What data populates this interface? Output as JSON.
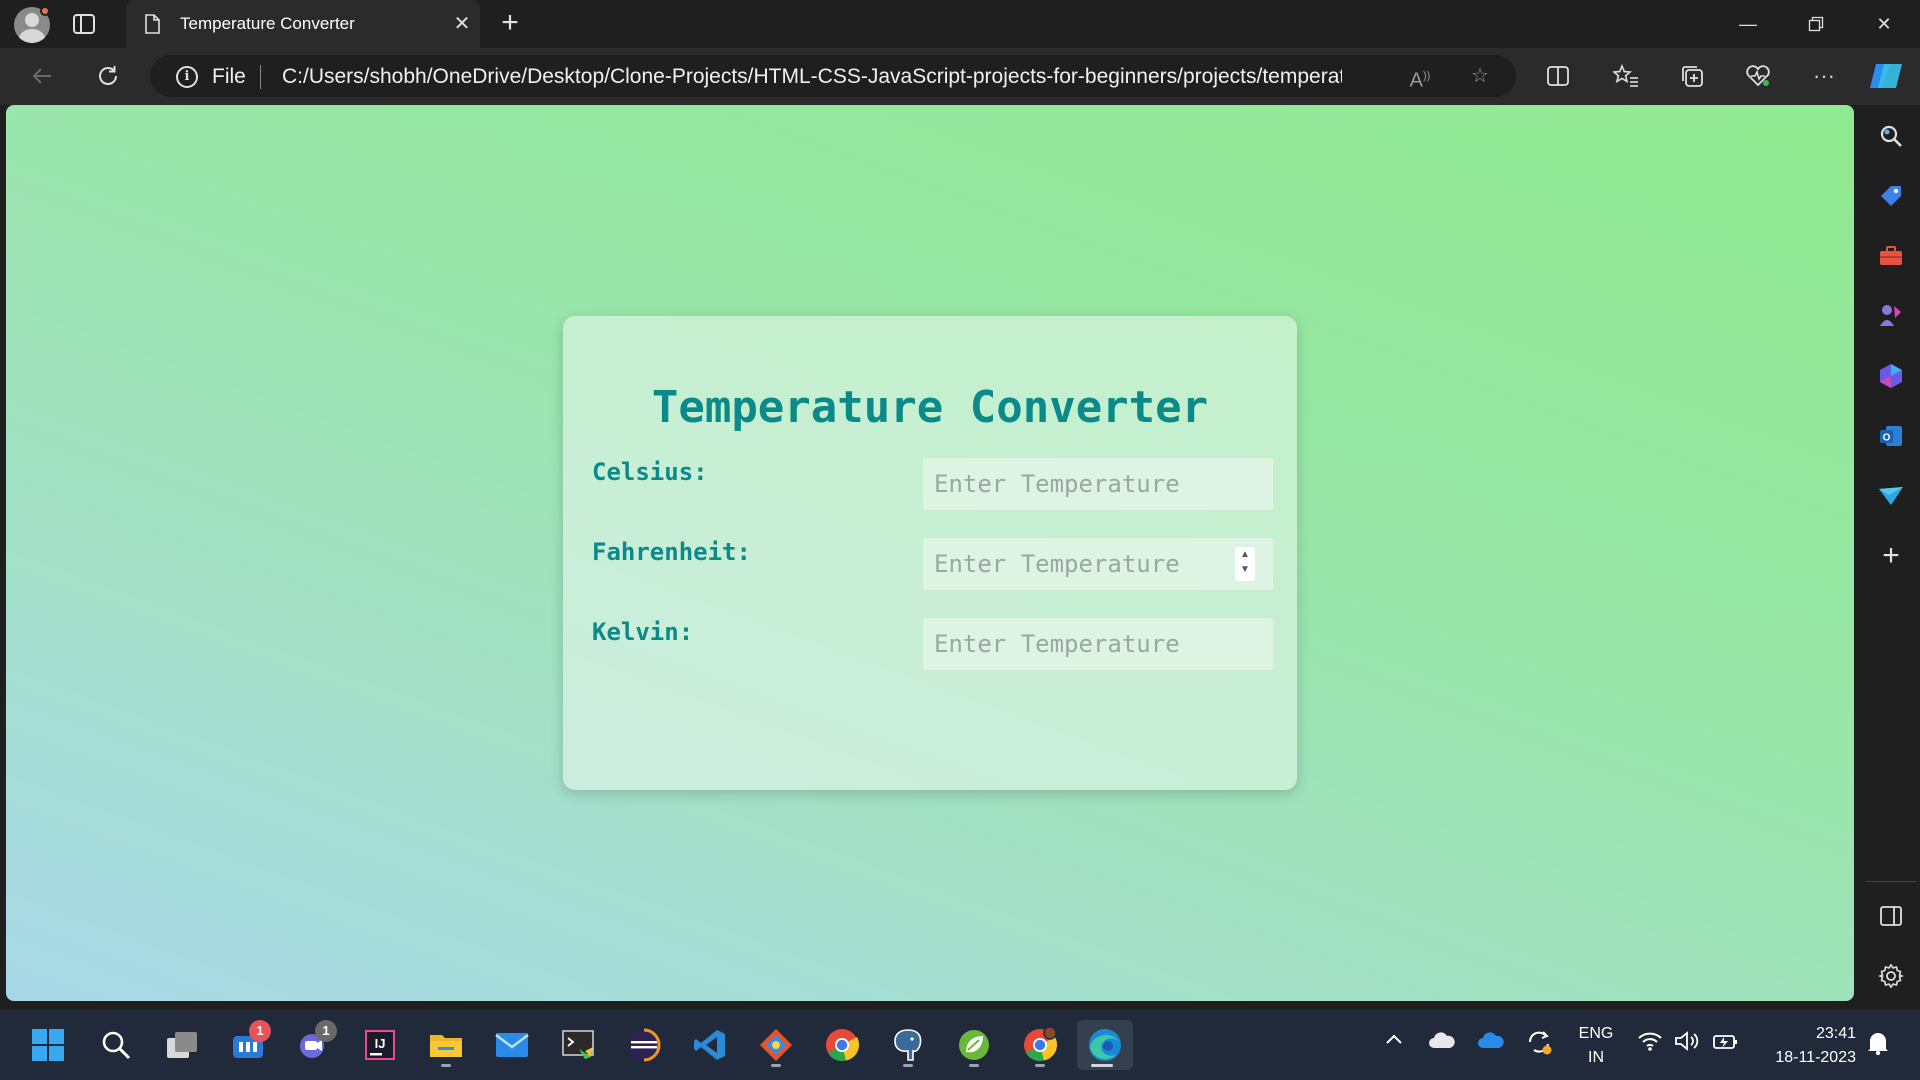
{
  "browser": {
    "tab_title": "Temperature Converter",
    "address_scheme": "File",
    "address_url": "C:/Users/shobh/OneDrive/Desktop/Clone-Projects/HTML-CSS-JavaScript-projects-for-beginners/projects/temperatur..."
  },
  "app": {
    "title": "Temperature Converter",
    "fields": [
      {
        "label": "Celsius:",
        "placeholder": "Enter Temperature",
        "value": ""
      },
      {
        "label": "Fahrenheit:",
        "placeholder": "Enter Temperature",
        "value": ""
      },
      {
        "label": "Kelvin:",
        "placeholder": "Enter Temperature",
        "value": ""
      }
    ],
    "colors": {
      "accent": "#0a8a88",
      "background_start": "#a8d8e8",
      "background_end": "#90ea90"
    }
  },
  "sidebar": {
    "icons": [
      "search-icon",
      "shopping-tag-icon",
      "tools-icon",
      "games-icon",
      "copilot-icon",
      "outlook-icon",
      "send-icon",
      "add-icon",
      "split-panel-icon",
      "settings-icon"
    ]
  },
  "taskbar": {
    "badges": {
      "teams": "1",
      "chat": "1"
    },
    "language_line1": "ENG",
    "language_line2": "IN",
    "time": "23:41",
    "date": "18-11-2023"
  }
}
